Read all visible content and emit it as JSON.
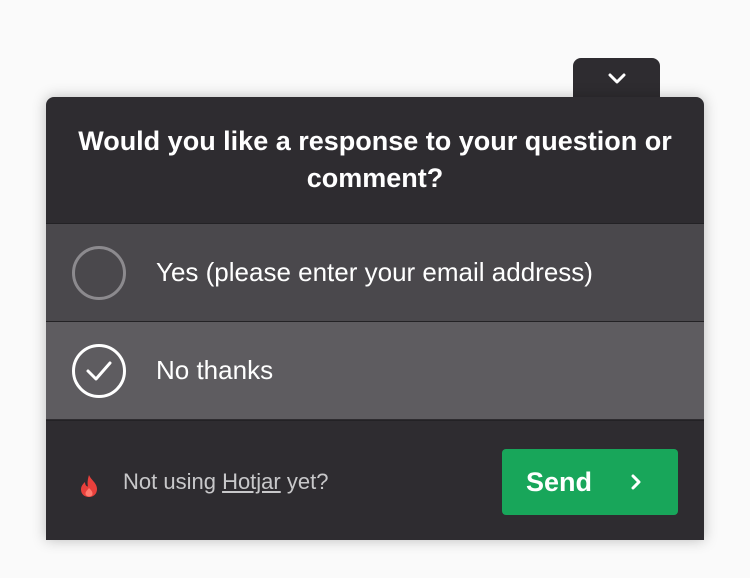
{
  "widget": {
    "question": "Would you like a response to your question or comment?",
    "options": [
      {
        "label": "Yes (please enter your email address)",
        "selected": false
      },
      {
        "label": "No thanks",
        "selected": true
      }
    ],
    "footer": {
      "prefix": "Not using ",
      "brand_link": "Hotjar",
      "suffix": " yet?"
    },
    "send_label": "Send"
  },
  "icons": {
    "collapse": "chevron-down-icon",
    "brand": "flame-icon",
    "check": "check-icon",
    "send": "chevron-right-icon"
  },
  "colors": {
    "panel": "#2e2c30",
    "option_unselected": "#4a484c",
    "option_selected": "#5e5c60",
    "send_button": "#18a65a",
    "brand_flame": "#e8403c"
  }
}
